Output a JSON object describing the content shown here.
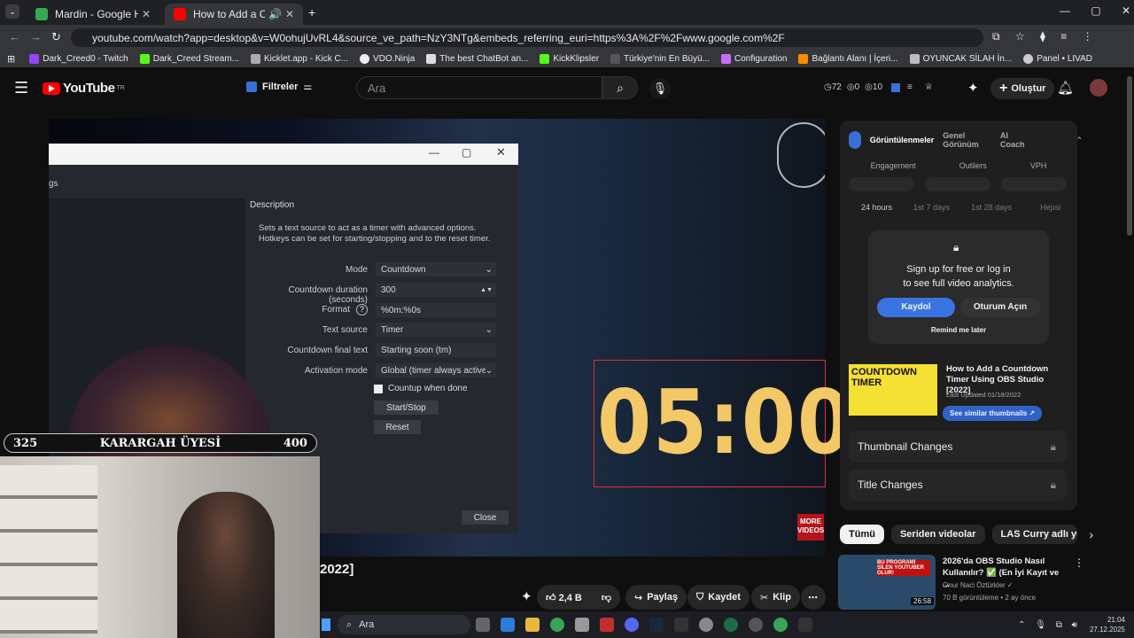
{
  "browser": {
    "tabs": [
      {
        "title": "Mardin - Google Haritalar"
      },
      {
        "title": "How to Add a Countdown"
      }
    ],
    "url": "youtube.com/watch?app=desktop&v=W0ohujUvRL4&source_ve_path=NzY3NTg&embeds_referring_euri=https%3A%2F%2Fwww.google.com%2F",
    "bookmarks": [
      "Dark_Creed0 - Twitch",
      "Dark_Creed Stream...",
      "Kicklet.app - Kick C...",
      "VDO.Ninja",
      "The best ChatBot an...",
      "KickKlipsler",
      "Türkiye'nin En Büyü...",
      "Configuration",
      "Bağlantı Alanı | İçeri...",
      "OYUNCAK SİLAH İn...",
      "Panel • LIVAD"
    ]
  },
  "youtube": {
    "logo": "YouTube",
    "logo_sup": "TR",
    "filters_label": "Filtreler",
    "search_placeholder": "Ara",
    "stats": [
      "72",
      "0",
      "10"
    ],
    "create_label": "Oluştur"
  },
  "obs": {
    "section_label": "gs",
    "description_title": "Description",
    "description_text": "Sets a text source to act as a timer with advanced options.\nHotkeys can be set for starting/stopping and to the reset timer.",
    "fields": [
      {
        "label": "Mode",
        "value": "Countdown"
      },
      {
        "label": "Countdown duration (seconds)",
        "value": "300"
      },
      {
        "label": "Format",
        "value": "%0m:%0s"
      },
      {
        "label": "Text source",
        "value": "Timer"
      },
      {
        "label": "Countdown final text",
        "value": "Starting soon (tm)"
      },
      {
        "label": "Activation mode",
        "value": "Global (timer always active)"
      }
    ],
    "checkbox": "Countup when done",
    "start_stop": "Start/Stop",
    "reset": "Reset",
    "close": "Close"
  },
  "video": {
    "timer": "05:00",
    "more_videos": "MORE\nVIDEOS",
    "title_fragment": "2022]"
  },
  "overlay": {
    "left_score": "325",
    "label": "KARARGAH ÜYESİ",
    "right_score": "400"
  },
  "panel": {
    "tabs": [
      "Görüntülenmeler",
      "Genel Görünüm",
      "AI Coach"
    ],
    "metrics": [
      "Engagement",
      "Outliers",
      "VPH"
    ],
    "ranges": [
      "24 hours",
      "1st 7 days",
      "1st 28 days",
      "Hepsi"
    ],
    "signup_line1": "Sign up for free or log in",
    "signup_line2": "to see full video analytics.",
    "register": "Kaydol",
    "login": "Oturum Açın",
    "remind": "Remind me later",
    "thumb_text": "COUNTDOWN TIMER",
    "video_title": "How to Add a Countdown Timer Using OBS Studio [2022]",
    "last_updated": "Last Updated 01/18/2022",
    "similar": "See similar thumbnails",
    "cards": [
      "Thumbnail Changes",
      "Title Changes"
    ]
  },
  "chips": [
    "Tümü",
    "Seriden videolar",
    "LAS Curry adlı yükley"
  ],
  "rec": {
    "title": "2026'da OBS Studio Nasıl Kullanılır? ✅ (En İyi Kayıt ve ...",
    "channel": "Onur Naci Öztürkler",
    "meta": "70 B görüntüleme • 2 ay önce",
    "duration": "26:58",
    "thumb_text": "BU PROGRAMI SİLEN YOUTUBER OLUR!"
  },
  "actions": {
    "likes": "2,4 B",
    "share": "Paylaş",
    "save": "Kaydet",
    "clip": "Klip"
  },
  "taskbar": {
    "search": "Ara",
    "time": "21:04",
    "date": "27.12.2025"
  },
  "colors": {
    "accent": "#3ea6ff",
    "yt_red": "#ff0000",
    "timer_gold": "#f3c866"
  }
}
